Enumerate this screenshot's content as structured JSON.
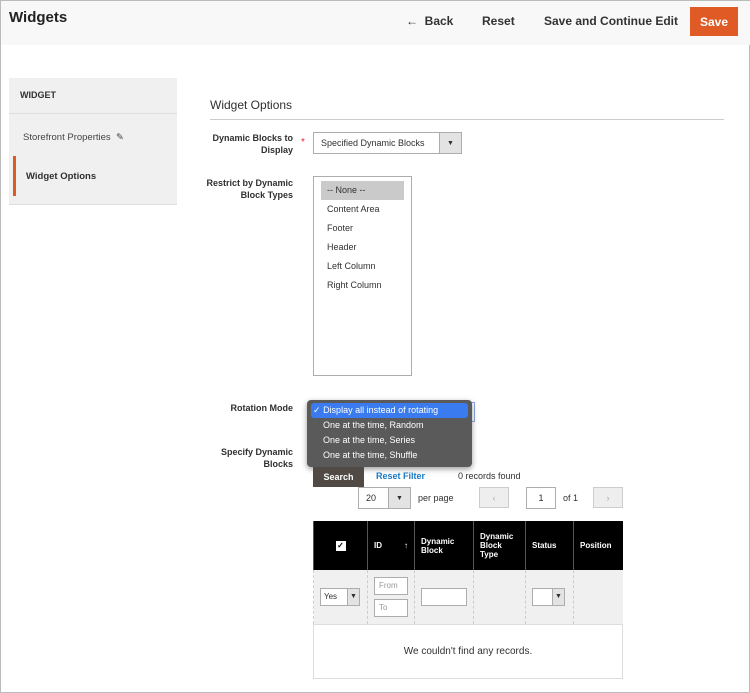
{
  "header": {
    "title": "Widgets",
    "back": "Back",
    "reset": "Reset",
    "save_continue": "Save and Continue Edit",
    "save": "Save"
  },
  "sidebar": {
    "heading": "WIDGET",
    "items": [
      {
        "label": "Storefront Properties"
      },
      {
        "label": "Widget Options"
      }
    ]
  },
  "section": {
    "title": "Widget Options"
  },
  "fields": {
    "dynamic_blocks_label": "Dynamic Blocks to Display",
    "dynamic_blocks_value": "Specified Dynamic Blocks",
    "restrict_label": "Restrict by Dynamic Block Types",
    "restrict_options": [
      "-- None --",
      "Content Area",
      "Footer",
      "Header",
      "Left Column",
      "Right Column"
    ],
    "rotation_label": "Rotation Mode",
    "rotation_options": [
      "Display all instead of rotating",
      "One at the time, Random",
      "One at the time, Series",
      "One at the time, Shuffle"
    ],
    "specify_label": "Specify Dynamic Blocks"
  },
  "grid": {
    "search": "Search",
    "reset_filter": "Reset Filter",
    "records": "0 records found",
    "per_page_value": "20",
    "per_page_label": "per page",
    "page": "1",
    "of": "of 1",
    "columns": [
      "ID",
      "Dynamic Block",
      "Dynamic Block Type",
      "Status",
      "Position"
    ],
    "filter_yes": "Yes",
    "from_placeholder": "From",
    "to_placeholder": "To",
    "empty": "We couldn't find any records."
  }
}
